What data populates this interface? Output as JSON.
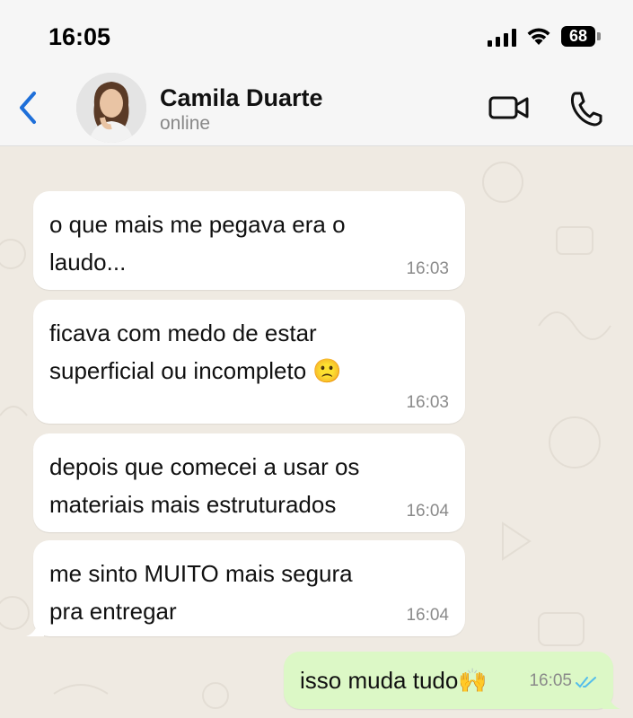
{
  "status_bar": {
    "time": "16:05",
    "battery": "68"
  },
  "header": {
    "contact_name": "Camila Duarte",
    "status": "online"
  },
  "messages": [
    {
      "direction": "in",
      "text": "o que mais me pegava era o\nlaudo...",
      "time": "16:03"
    },
    {
      "direction": "in",
      "text": "ficava com medo de estar\nsuperficial ou incompleto 🙁",
      "time": "16:03"
    },
    {
      "direction": "in",
      "text": "depois que comecei a usar os\nmateriais mais estruturados",
      "time": "16:04"
    },
    {
      "direction": "in",
      "text": "me sinto MUITO mais segura\npra entregar",
      "time": "16:04"
    },
    {
      "direction": "out",
      "text": "isso muda tudo🙌",
      "time": "16:05",
      "read": true
    }
  ],
  "colors": {
    "accent": "#1e6fd9",
    "outgoing_bubble": "#dcf8c6",
    "incoming_bubble": "#ffffff",
    "background": "#efeae2",
    "read_ticks": "#53bdeb"
  }
}
